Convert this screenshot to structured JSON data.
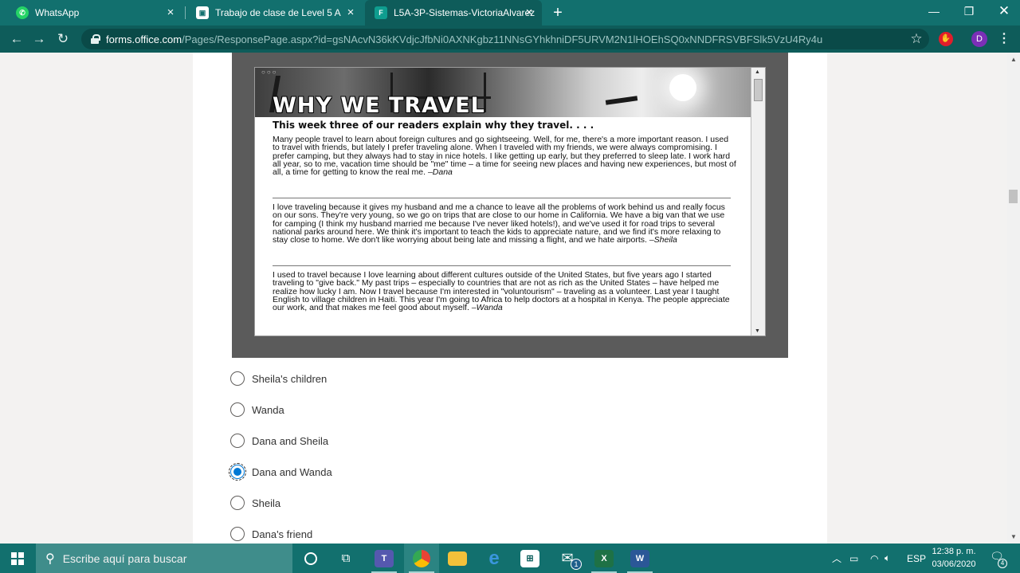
{
  "browser": {
    "tabs": [
      {
        "title": "WhatsApp",
        "icon": "whatsapp-icon"
      },
      {
        "title": "Trabajo de clase de Level 5 A",
        "icon": "classroom-icon"
      },
      {
        "title": "L5A-3P-Sistemas-VictoriaAlvarez",
        "icon": "forms-icon"
      }
    ],
    "active_tab_index": 2,
    "url_host": "forms.office.com",
    "url_path": "/Pages/ResponsePage.aspx?id=gsNAcvN36kKVdjcJfbNi0AXNKgbz11NNsGYhkhniDF5URVM2N1lHOEhSQ0xNNDFRSVBFSlk5VzU4Ry4u",
    "profile_initial": "D",
    "colors": {
      "frame": "#12706e",
      "toolbar": "#0e5c5a"
    }
  },
  "article": {
    "title": "WHY WE TRAVEL",
    "intro": "This week three of our readers explain why they travel. . . .",
    "paragraphs": [
      {
        "text": "Many people travel to learn about foreign cultures and go sightseeing. Well, for me, there's a more important reason. I used to travel with friends, but lately I prefer traveling alone. When I traveled with my friends, we were always compromising. I prefer camping, but they always had to stay in nice hotels. I like getting up early, but they preferred to sleep late. I work hard all year, so to me, vacation time should be \"me\" time – a time for seeing new places and having new experiences, but most of all, a time for getting to know the real me.",
        "signature": "–Dana"
      },
      {
        "text": "I love traveling because it gives my husband and me a chance to leave all the problems of work behind us and really focus on our sons. They're very young, so we go on trips that are close to our home in California. We have a big van that we use for camping (I think my husband married me because I've never liked hotels!), and we've used it for road trips to several national parks around here. We think it's important to teach the kids to appreciate nature, and we find it's more relaxing to stay close to home. We don't like worrying about being late and missing a flight, and we hate airports.",
        "signature": "–Sheila"
      },
      {
        "text": "I used to travel because I love learning about different cultures outside of the United States, but five years ago I started traveling to \"give back.\" My past trips – especially to countries that are not as rich as the United States – have helped me realize how lucky I am. Now I travel because I'm interested in \"voluntourism\" – traveling as a volunteer. Last year I taught English to village children in Haiti. This year I'm going to Africa to help doctors at a hospital in Kenya. The people appreciate our work, and that makes me feel good about myself.",
        "signature": "–Wanda"
      }
    ]
  },
  "question": {
    "options": [
      {
        "label": "Sheila's children",
        "selected": false
      },
      {
        "label": "Wanda",
        "selected": false
      },
      {
        "label": "Dana and Sheila",
        "selected": false
      },
      {
        "label": "Dana and Wanda",
        "selected": true
      },
      {
        "label": "Sheila",
        "selected": false
      },
      {
        "label": "Dana's friend",
        "selected": false
      }
    ],
    "accent_color": "#0078d4"
  },
  "taskbar": {
    "search_placeholder": "Escribe aquí para buscar",
    "language": "ESP",
    "time": "12:38 p. m.",
    "date": "03/06/2020",
    "mail_badge": "1",
    "notification_count": "4",
    "colors": {
      "bar": "#12706e",
      "search": "#3f8d8b"
    }
  }
}
